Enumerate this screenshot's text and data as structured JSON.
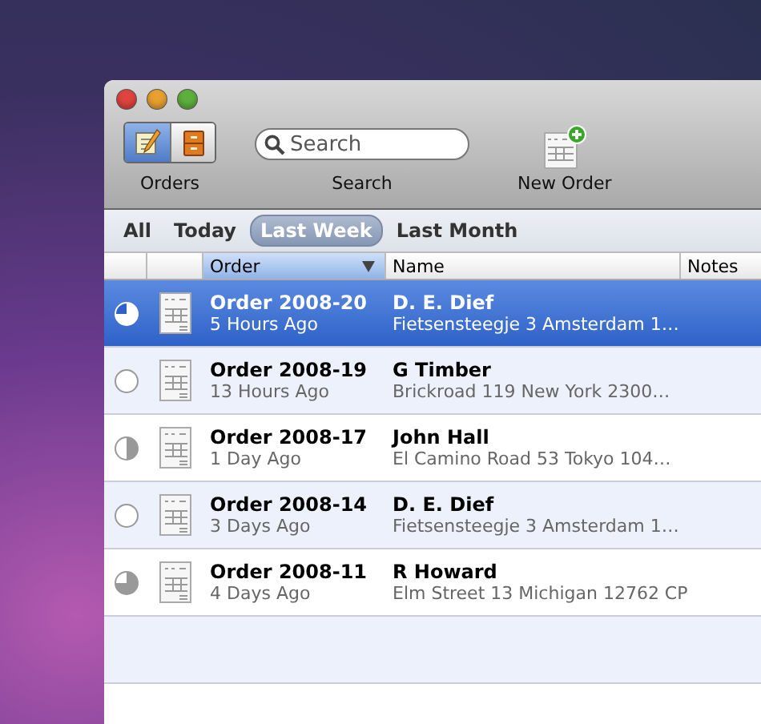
{
  "toolbar": {
    "view_switch": {
      "label": "Orders",
      "segments": [
        {
          "selected": true
        },
        {
          "selected": false
        }
      ]
    },
    "search": {
      "placeholder": "Search",
      "label": "Search"
    },
    "new_order": {
      "label": "New Order"
    }
  },
  "scope_bar": [
    {
      "label": "All",
      "selected": false
    },
    {
      "label": "Today",
      "selected": false
    },
    {
      "label": "Last Week",
      "selected": true
    },
    {
      "label": "Last Month",
      "selected": false
    }
  ],
  "table": {
    "columns": [
      {
        "label": "Order",
        "sorted": true
      },
      {
        "label": "Name",
        "sorted": false
      },
      {
        "label": "Notes",
        "sorted": false
      }
    ],
    "rows": [
      {
        "kind": "threequarter",
        "order": "Order 2008-20",
        "age": "5 Hours Ago",
        "name": "D. E. Dief",
        "address": "Fietsensteegje 3 Amsterdam 1…",
        "selected": true
      },
      {
        "kind": "empty",
        "order": "Order 2008-19",
        "age": "13 Hours Ago",
        "name": "G Timber",
        "address": "Brickroad 119 New York 2300…",
        "selected": false
      },
      {
        "kind": "half",
        "order": "Order 2008-17",
        "age": "1 Day Ago",
        "name": "John Hall",
        "address": "El Camino Road 53 Tokyo 104…",
        "selected": false
      },
      {
        "kind": "empty",
        "order": "Order 2008-14",
        "age": "3 Days Ago",
        "name": "D. E. Dief",
        "address": "Fietsensteegje 3 Amsterdam 1…",
        "selected": false
      },
      {
        "kind": "threequarter",
        "order": "Order 2008-11",
        "age": "4 Days Ago",
        "name": "R Howard",
        "address": "Elm Street 13 Michigan 12762 CP",
        "selected": false
      }
    ]
  }
}
